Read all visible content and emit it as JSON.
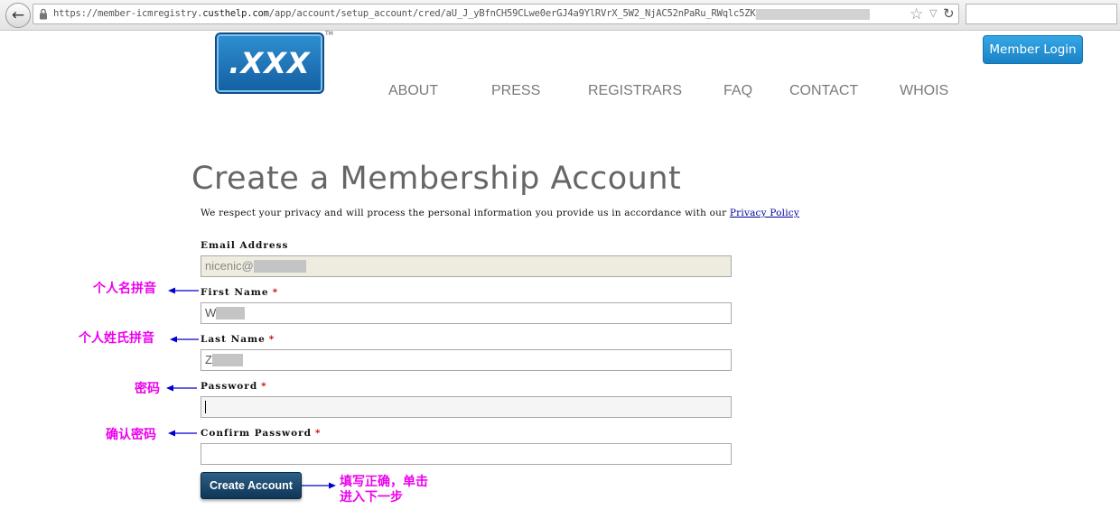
{
  "browser": {
    "url_prefix": "https://member-icmregistry.",
    "url_domain": "custhelp.com",
    "url_path": "/app/account/setup_account/cred/aU_J_yBfnCH59CLwe0erGJ4a9YlRVrX_5W2_NjAC52nPaRu_RWqlc5ZK_1"
  },
  "header": {
    "logo_text": ".XXX",
    "logo_tm": "TM",
    "nav": [
      "ABOUT",
      "PRESS",
      "REGISTRARS",
      "FAQ",
      "CONTACT",
      "WHOIS"
    ],
    "member_login": "Member Login"
  },
  "main": {
    "title": "Create a Membership Account",
    "privacy_text": "We respect your privacy and will process the personal information you provide us in accordance with our",
    "privacy_link": "Privacy Policy",
    "required_mark": "*",
    "email": {
      "label": "Email Address",
      "value": "nicenic@"
    },
    "first_name": {
      "label": "First Name",
      "value": "W"
    },
    "last_name": {
      "label": "Last Name",
      "value": "Z"
    },
    "password": {
      "label": "Password",
      "value": ""
    },
    "confirm_password": {
      "label": "Confirm Password",
      "value": ""
    },
    "submit": "Create Account"
  },
  "annotations": {
    "first_name": "个人名拼音",
    "last_name": "个人姓氏拼音",
    "password": "密码",
    "confirm_password": "确认密码",
    "submit_line1": "填写正确，单击",
    "submit_line2": "进入下一步"
  },
  "colors": {
    "annotation": "#ee00ee",
    "arrow": "#0000cc",
    "required": "#c00000",
    "login_button": "#1a82c6",
    "create_button": "#0e3657"
  }
}
